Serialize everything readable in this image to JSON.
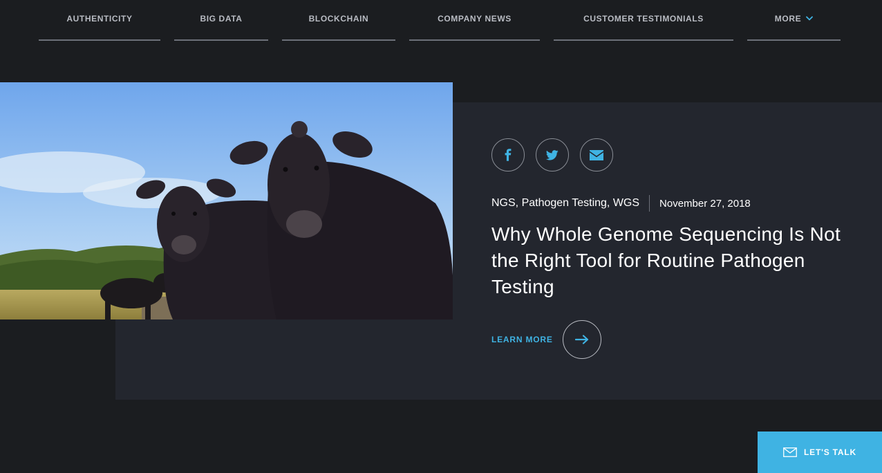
{
  "nav": {
    "items": [
      {
        "label": "AUTHENTICITY"
      },
      {
        "label": "BIG DATA"
      },
      {
        "label": "BLOCKCHAIN"
      },
      {
        "label": "COMPANY NEWS"
      },
      {
        "label": "CUSTOMER TESTIMONIALS"
      },
      {
        "label": "MORE"
      }
    ]
  },
  "post": {
    "image_icon": "cattle-photo",
    "share": [
      {
        "icon": "facebook-icon"
      },
      {
        "icon": "twitter-icon"
      },
      {
        "icon": "email-icon"
      }
    ],
    "tags": "NGS, Pathogen Testing, WGS",
    "date": "November 27, 2018",
    "title": "Why Whole Genome Sequencing Is Not the Right Tool for Routine Pathogen Testing",
    "learn_more_label": "LEARN MORE",
    "learn_more_icon": "arrow-right-icon"
  },
  "cta": {
    "label": "LET'S TALK",
    "icon": "mail-icon"
  },
  "colors": {
    "background": "#1b1d20",
    "card": "#23262e",
    "accent": "#3fb3e3",
    "nav_text": "#b9bcc3"
  }
}
